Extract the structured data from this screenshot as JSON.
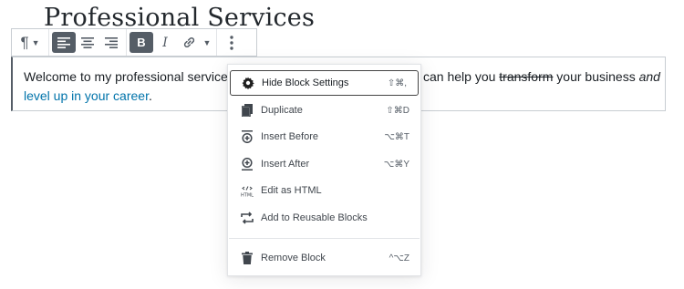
{
  "page": {
    "title": "Professional Services"
  },
  "block": {
    "text_before": "Welcome to my professional services p",
    "text_after_visible": "can help you ",
    "strike_word": "transform",
    "after_strike": " your business ",
    "italic_word": "and",
    "link_text": "level up in your career",
    "end_punct": "."
  },
  "toolbar": {
    "icons": [
      "paragraph-icon",
      "align-left-icon",
      "align-center-icon",
      "align-right-icon",
      "bold-icon",
      "italic-icon",
      "link-icon",
      "more-rich-text-icon",
      "more-options-icon"
    ],
    "bold_label": "B",
    "italic_label": "I",
    "paragraph_label": "¶"
  },
  "menu": {
    "items": [
      {
        "label": "Hide Block Settings",
        "shortcut": "⇧⌘,",
        "icon": "gear-icon"
      },
      {
        "label": "Duplicate",
        "shortcut": "⇧⌘D",
        "icon": "duplicate-icon"
      },
      {
        "label": "Insert Before",
        "shortcut": "⌥⌘T",
        "icon": "insert-before-icon"
      },
      {
        "label": "Insert After",
        "shortcut": "⌥⌘Y",
        "icon": "insert-after-icon"
      },
      {
        "label": "Edit as HTML",
        "shortcut": "",
        "icon": "html-icon"
      },
      {
        "label": "Add to Reusable Blocks",
        "shortcut": "",
        "icon": "reusable-block-icon"
      },
      {
        "label": "Remove Block",
        "shortcut": "^⌥Z",
        "icon": "trash-icon"
      }
    ]
  }
}
